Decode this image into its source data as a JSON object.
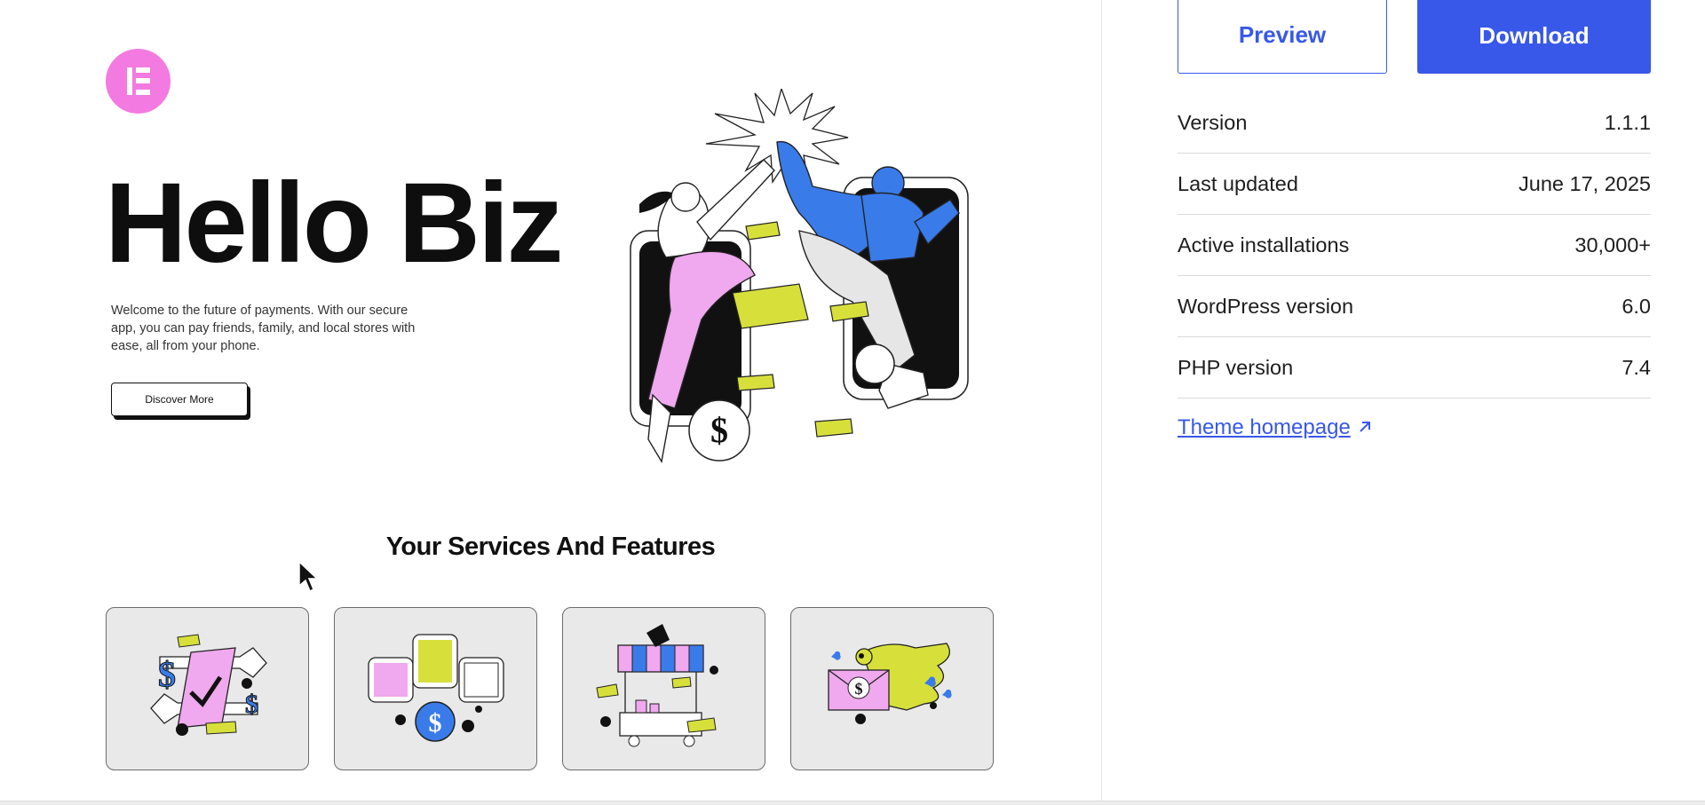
{
  "preview": {
    "hero_title": "Hello Biz",
    "hero_description": "Welcome to the future of payments. With our secure app, you can pay friends, family, and local stores with ease, all from your phone.",
    "discover_button": "Discover More",
    "services_title": "Your Services And Features"
  },
  "sidebar": {
    "preview_button": "Preview",
    "download_button": "Download",
    "meta": [
      {
        "label": "Version",
        "value": "1.1.1"
      },
      {
        "label": "Last updated",
        "value": "June 17, 2025"
      },
      {
        "label": "Active installations",
        "value": "30,000+"
      },
      {
        "label": "WordPress version",
        "value": "6.0"
      },
      {
        "label": "PHP version",
        "value": "7.4"
      }
    ],
    "homepage_link": "Theme homepage",
    "homepage_link_icon": "external-arrow-icon"
  },
  "colors": {
    "accent": "#3858e9",
    "logo_pink": "#f37ae0",
    "illustration_blue": "#3a7bea",
    "illustration_pink": "#f0a8ee",
    "illustration_yellow": "#d7e03b"
  }
}
